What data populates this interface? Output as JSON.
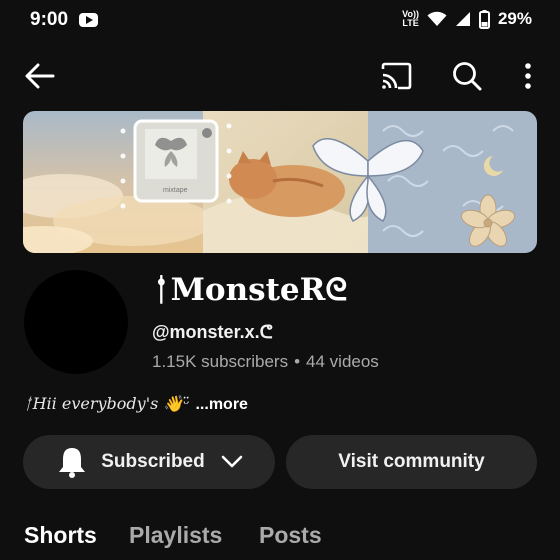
{
  "status_bar": {
    "time": "9:00",
    "volte_top": "Vo))",
    "volte_bottom": "LTE",
    "battery_percent": "29%",
    "icons": [
      "youtube-notification-icon",
      "wifi-icon",
      "signal-icon",
      "battery-icon"
    ]
  },
  "app_bar": {
    "icons": [
      "back-arrow-icon",
      "cast-icon",
      "search-icon",
      "more-vert-icon"
    ]
  },
  "banner": {
    "card_label": "mixtape"
  },
  "channel": {
    "name": "ᛁ̊MonsteRᘓ",
    "handle": "@monster.x.ᕦ",
    "subscribers": "1.15K subscribers",
    "videos": "44 videos",
    "separator": "•"
  },
  "description": {
    "text": "ᛁ̊Hii everybody's 👋ᵕ̈",
    "more": "...more"
  },
  "actions": {
    "subscribed_label": "Subscribed",
    "community_label": "Visit community"
  },
  "tabs": [
    {
      "label": "Shorts",
      "active": true
    },
    {
      "label": "Playlists",
      "active": false
    },
    {
      "label": "Posts",
      "active": false
    }
  ],
  "colors": {
    "background": "#0f0f0f",
    "pill": "#272727",
    "secondary_text": "#aaaaaa"
  }
}
